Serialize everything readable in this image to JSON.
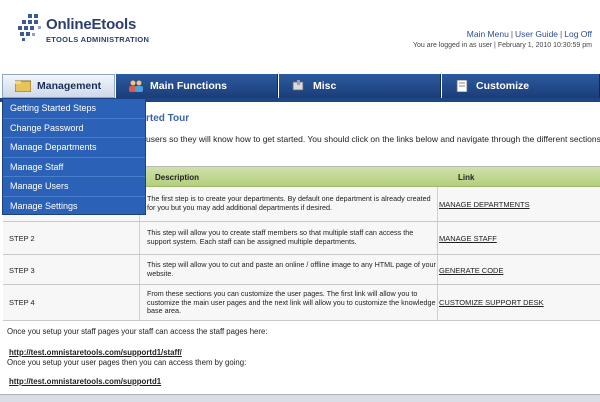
{
  "header": {
    "logo_name": "OnlineEtools",
    "logo_sub": "ETOOLS ADMINISTRATION",
    "links": [
      "Main Menu",
      "User Guide",
      "Log Off"
    ],
    "login_info": "You are logged in as user | February 1, 2010 10:30:59 pm"
  },
  "tabs": [
    {
      "label": "Management",
      "icon": "folder-icon"
    },
    {
      "label": "Main Functions",
      "icon": "users-icon"
    },
    {
      "label": "Misc",
      "icon": "tools-icon"
    },
    {
      "label": "Customize",
      "icon": "document-icon"
    }
  ],
  "dropdown": {
    "items": [
      "Getting Started Steps",
      "Change Password",
      "Manage Departments",
      "Manage Staff",
      "Manage Users",
      "Manage Settings"
    ]
  },
  "content": {
    "title_partial": "rted Tour",
    "intro_partial": "users so they will know how to get started. You should click on the links below and navigate through the different sections",
    "columns": [
      "Description",
      "Link"
    ],
    "rows": [
      {
        "step": "",
        "desc": "The first step is to create your departments. By default one department is already created for you but you may add additional departments if desired.",
        "link": "MANAGE DEPARTMENTS"
      },
      {
        "step": "STEP 2",
        "desc": "This step will allow you to create staff members so that multiple staff can access the support system. Each staff can be assigned multiple departments.",
        "link": "MANAGE STAFF"
      },
      {
        "step": "STEP 3",
        "desc": "This step will allow you to cut and paste an online / offline image to any HTML page of your website.",
        "link": "GENERATE CODE"
      },
      {
        "step": "STEP 4",
        "desc": "From these sections you can customize the user pages. The first link will allow you to customize the main user pages and the next link will allow you to customize the knowledge base area.",
        "link": "CUSTOMIZE SUPPORT DESK"
      }
    ],
    "staff_note": "Once you setup your staff pages your staff can access the staff pages here:",
    "staff_url": "http://test.omnistaretools.com/supportd1/staff/",
    "user_note": "Once you setup your user pages then you can access them by going:",
    "user_url": "http://test.omnistaretools.com/supportd1"
  },
  "colors": {
    "tab_blue": "#1f4585",
    "dropdown_blue": "#2b62b8",
    "header_green": "#b4cf7d",
    "link_blue": "#2d4d8c"
  }
}
